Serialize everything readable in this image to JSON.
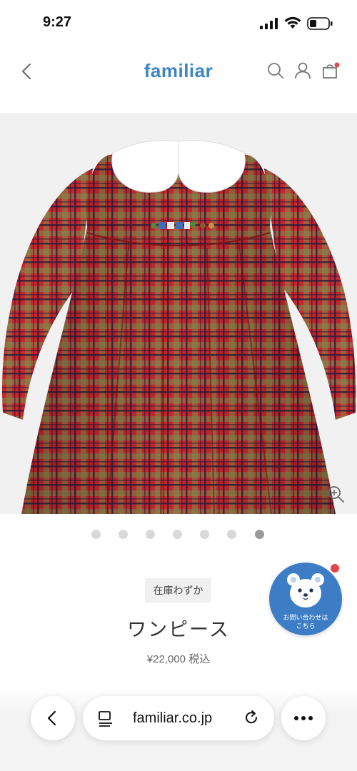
{
  "status": {
    "time": "9:27"
  },
  "header": {
    "brand": "familiar",
    "icons": [
      "back-chevron-icon",
      "search-icon",
      "account-icon",
      "cart-icon"
    ],
    "brand_color": "#3d84c6",
    "cart_badge_color": "#e0474c"
  },
  "gallery": {
    "image": "red-plaid-dress-with-white-collar",
    "pager_count": 7,
    "active_index": 6
  },
  "product": {
    "stock_badge": "在庫わずか",
    "name": "ワンピース",
    "price": "¥22,000",
    "tax_label": "税込"
  },
  "contact": {
    "label_line1": "お問い合わせは",
    "label_line2": "こちら",
    "color": "#3d7dc6"
  },
  "browser": {
    "url": "familiar.co.jp"
  }
}
